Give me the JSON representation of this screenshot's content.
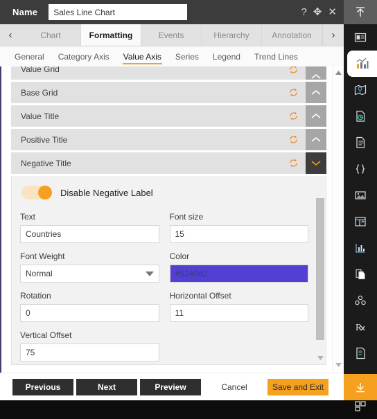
{
  "titlebar": {
    "name_label": "Name",
    "name_value": "Sales Line Chart",
    "icons": [
      {
        "name": "help-icon",
        "glyph": "?"
      },
      {
        "name": "move-icon",
        "glyph": "✥"
      },
      {
        "name": "close-icon",
        "glyph": "✕"
      }
    ]
  },
  "tabs": {
    "prev_glyph": "‹",
    "next_glyph": "›",
    "items": [
      {
        "label": "Chart",
        "active": false
      },
      {
        "label": "Formatting",
        "active": true
      },
      {
        "label": "Events",
        "active": false
      },
      {
        "label": "Hierarchy",
        "active": false
      },
      {
        "label": "Annotation",
        "active": false
      }
    ]
  },
  "subtabs": {
    "items": [
      {
        "label": "General",
        "active": false
      },
      {
        "label": "Category Axis",
        "active": false
      },
      {
        "label": "Value Axis",
        "active": true
      },
      {
        "label": "Series",
        "active": false
      },
      {
        "label": "Legend",
        "active": false
      },
      {
        "label": "Trend Lines",
        "active": false
      }
    ]
  },
  "accordions": [
    {
      "label": "Value Grid",
      "open": false,
      "clipped": true
    },
    {
      "label": "Base Grid",
      "open": false,
      "clipped": false
    },
    {
      "label": "Value Title",
      "open": false,
      "clipped": false
    },
    {
      "label": "Positive Title",
      "open": false,
      "clipped": false
    },
    {
      "label": "Negative Title",
      "open": true,
      "clipped": false
    }
  ],
  "form": {
    "toggle": {
      "label": "Disable Negative Label",
      "state": "on"
    },
    "fields": [
      {
        "label": "Text",
        "value": "Countries",
        "type": "text"
      },
      {
        "label": "Font size",
        "value": "15",
        "type": "text"
      },
      {
        "label": "Font Weight",
        "value": "Normal",
        "type": "select"
      },
      {
        "label": "Color",
        "value": "#5240d2",
        "type": "color"
      },
      {
        "label": "Rotation",
        "value": "0",
        "type": "text"
      },
      {
        "label": "Horizontal Offset",
        "value": "11",
        "type": "text"
      },
      {
        "label": "Vertical Offset",
        "value": "75",
        "type": "text"
      }
    ]
  },
  "footer": {
    "buttons": [
      {
        "label": "Previous",
        "style": "dark"
      },
      {
        "label": "Next",
        "style": "dark"
      },
      {
        "label": "Preview",
        "style": "dark"
      },
      {
        "label": "Cancel",
        "style": "light"
      },
      {
        "label": "Save and Exit",
        "style": "accent"
      }
    ]
  },
  "rail": {
    "top_icon": "collapse-up-icon",
    "bottom_icon": "download-icon",
    "items": [
      {
        "name": "panel-icon",
        "selected": false
      },
      {
        "name": "bar-chart-icon",
        "selected": true
      },
      {
        "name": "map-icon",
        "selected": false
      },
      {
        "name": "document-chart-icon",
        "selected": false
      },
      {
        "name": "document-icon",
        "selected": false
      },
      {
        "name": "code-braces-icon",
        "selected": false
      },
      {
        "name": "image-icon",
        "selected": false
      },
      {
        "name": "table-icon",
        "selected": false
      },
      {
        "name": "analytics-icon",
        "selected": false
      },
      {
        "name": "copy-icon",
        "selected": false
      },
      {
        "name": "cube-icon",
        "selected": false
      },
      {
        "name": "prescription-icon",
        "selected": false
      },
      {
        "name": "report-icon",
        "selected": false
      },
      {
        "name": "layers-icon",
        "selected": false
      },
      {
        "name": "grid-icon",
        "selected": false
      }
    ]
  },
  "colors": {
    "accent": "#f5a01e",
    "swatch": "#5240d2",
    "titlebar": "#3c3c3c"
  }
}
